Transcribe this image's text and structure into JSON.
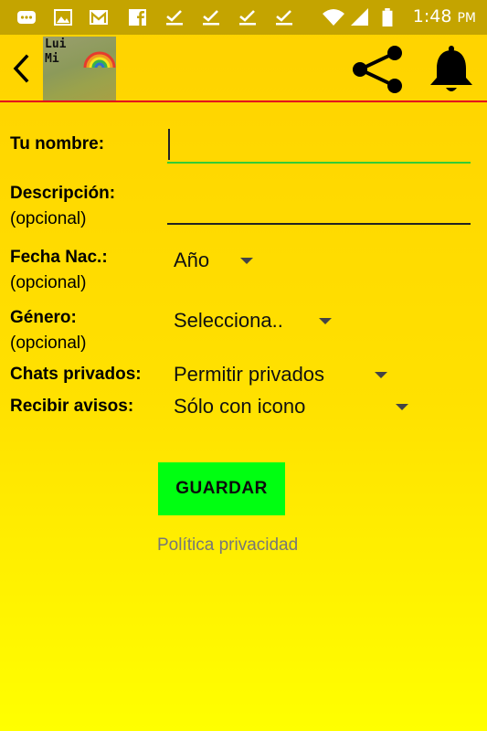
{
  "status_bar": {
    "time": "1:48",
    "time_suffix": "PM"
  },
  "toolbar": {
    "avatar_text": "Lui\nMi"
  },
  "form": {
    "name_label": "Tu nombre:",
    "name_value": "",
    "description_label": "Descripción:",
    "description_optional": "(opcional)",
    "description_value": "",
    "birth_label": "Fecha Nac.:",
    "birth_optional": "(opcional)",
    "birth_value": "Año",
    "gender_label": "Género:",
    "gender_optional": "(opcional)",
    "gender_value": "Selecciona..",
    "private_chats_label": "Chats privados:",
    "private_chats_value": "Permitir privados",
    "notifications_label": "Recibir avisos:",
    "notifications_value": "Sólo con icono",
    "save_label": "GUARDAR",
    "privacy_link": "Política privacidad"
  },
  "colors": {
    "background_top": "#ffd200",
    "background_bottom": "#ffff00",
    "status_bar": "#c4a400",
    "toolbar_divider": "#e4001b",
    "save_button": "#00ff11",
    "active_underline": "#33cc33"
  },
  "icons": {
    "status_left": [
      "message-icon",
      "image-icon",
      "gmail-icon",
      "facebook-icon",
      "check-icon",
      "check-icon",
      "check-icon",
      "check-icon"
    ],
    "status_right": [
      "wifi-icon",
      "signal-icon",
      "battery-icon"
    ],
    "toolbar": [
      "back-arrow-icon",
      "share-icon",
      "bell-icon"
    ]
  }
}
